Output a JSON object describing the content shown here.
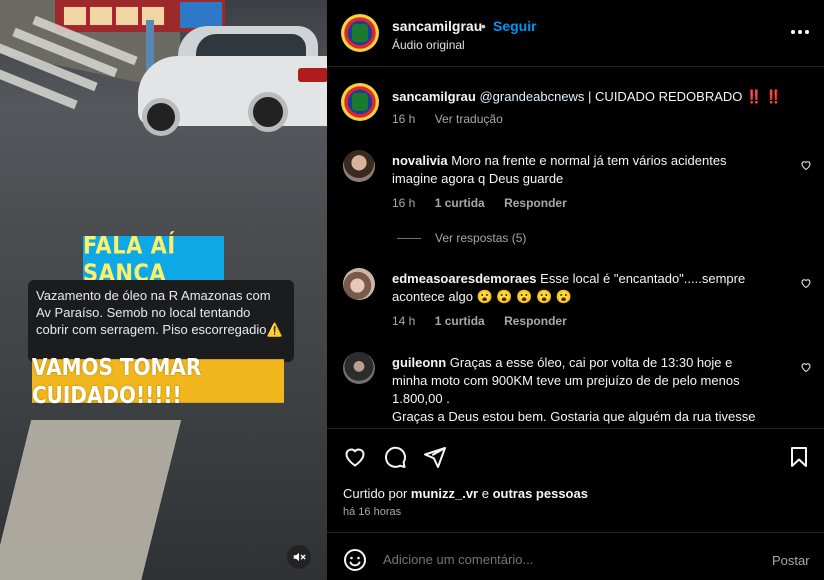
{
  "video": {
    "badge_top": "FALA AÍ SANCA",
    "caption": "Vazamento de óleo na R Amazonas com Av Paraíso.  Semob no local tentando cobrir com serragem. Piso escorregadio⚠️",
    "badge_bottom": "VAMOS TOMAR CUIDADO!!!!!",
    "mute_icon": "speaker-muted-icon"
  },
  "header": {
    "username": "sancamilgrau",
    "dot": "•",
    "follow_label": "Seguir",
    "audio": "Áudio original"
  },
  "post": {
    "username": "sancamilgrau",
    "mention": "@grandeabcnews",
    "text": " | CUIDADO REDOBRADO ",
    "bangs": "‼️ ‼️",
    "time": "16 h",
    "translate": "Ver tradução"
  },
  "comments": [
    {
      "username": "novalivia",
      "text": " Moro na frente e normal já tem vários acidentes imagine agora q Deus guarde",
      "time": "16 h",
      "likes": "1 curtida",
      "reply": "Responder",
      "view_replies": "Ver respostas (5)"
    },
    {
      "username": "edmeasoaresdemoraes",
      "text": " Esse local é \"encantado\".....sempre acontece algo 😮 😮 😮 😮 😮",
      "time": "14 h",
      "likes": "1 curtida",
      "reply": "Responder"
    },
    {
      "username": "guileonn",
      "text": " Graças a esse óleo, cai por volta de 13:30 hoje e minha moto com 900KM teve um prejuízo de de pelo menos 1.800,00 .",
      "text2": "Graças a Deus estou bem. Gostaria que alguém da rua tivesse"
    }
  ],
  "footer": {
    "liked_prefix": "Curtido por ",
    "liked_user": "munizz_.vr",
    "liked_mid": " e ",
    "liked_others": "outras pessoas",
    "ago": "há 16 horas",
    "comment_placeholder": "Adicione um comentário...",
    "post_label": "Postar"
  },
  "colors": {
    "link_blue": "#0095f6",
    "badge_blue": "#0fa8e6",
    "badge_yellow": "#f2b71c",
    "muted_text": "#a8a8a8"
  }
}
